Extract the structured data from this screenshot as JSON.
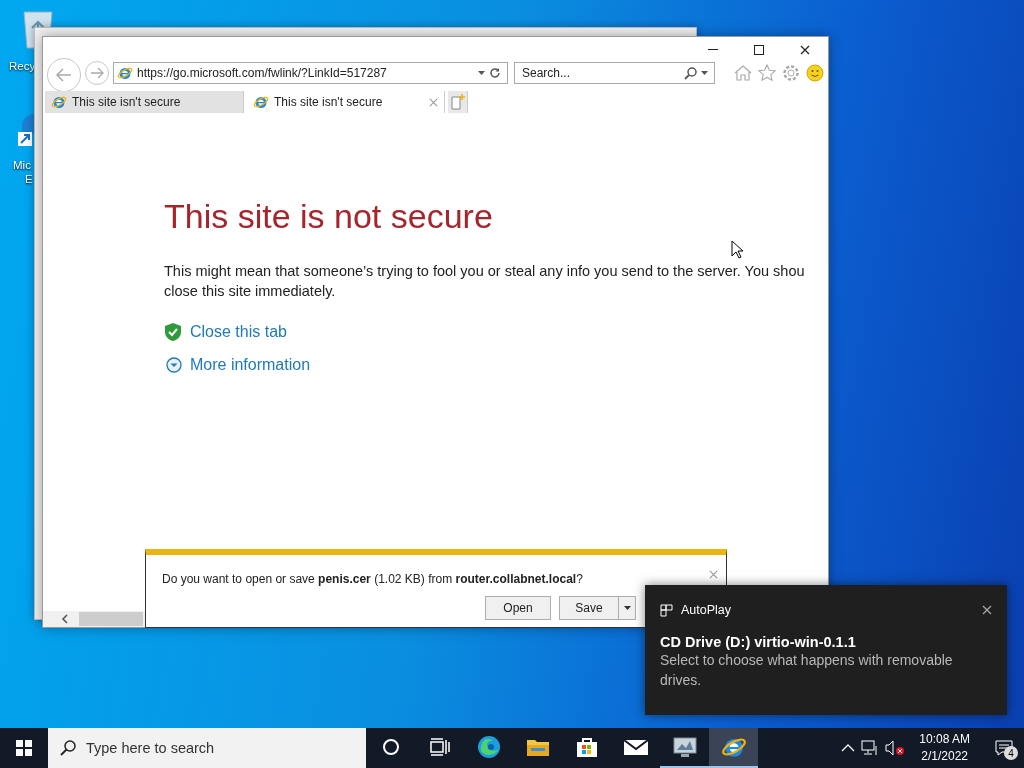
{
  "desktop": {
    "icons": [
      {
        "kind": "recycle",
        "label_lines": [
          "Recy"
        ]
      },
      {
        "kind": "edge",
        "label_lines": [
          "Mic",
          "E"
        ]
      }
    ]
  },
  "browser": {
    "address": "https://go.microsoft.com/fwlink/?LinkId=517287",
    "search": {
      "placeholder": "Search..."
    },
    "tabs": [
      {
        "label": "This site isn't secure",
        "selected": false
      },
      {
        "label": "This site isn't secure",
        "selected": true
      }
    ],
    "page": {
      "heading": "This site is not secure",
      "paragraph_lines": [
        "This might mean that someone’s trying to fool you or steal any info you send to the server. You shou",
        "close this site immediately."
      ],
      "links": [
        {
          "kind": "shield",
          "label": "Close this tab"
        },
        {
          "kind": "expand",
          "label": "More information"
        }
      ]
    }
  },
  "download_bar": {
    "message": "Do you want to open or save **penis.cer** (1.02 KB) from **router.collabnet.local**?",
    "buttons": [
      "Open",
      "Save"
    ]
  },
  "toast": {
    "app": "AutoPlay",
    "title": "CD Drive (D:) virtio-win-0.1.1",
    "body": "Select to choose what happens with removable drives."
  },
  "taskbar": {
    "search": {
      "placeholder": "Type here to search"
    },
    "apps": [
      {
        "kind": "cortana",
        "active": false,
        "running": false
      },
      {
        "kind": "taskview",
        "active": false,
        "running": false
      },
      {
        "kind": "edge",
        "active": false,
        "running": false
      },
      {
        "kind": "folder",
        "active": false,
        "running": false
      },
      {
        "kind": "store",
        "active": false,
        "running": false
      },
      {
        "kind": "mail",
        "active": false,
        "running": false
      },
      {
        "kind": "monitor",
        "active": false,
        "running": true
      },
      {
        "kind": "ie",
        "active": true,
        "running": true
      }
    ],
    "clock": {
      "time": "10:08 AM",
      "date": "2/1/2022"
    },
    "notifications": {
      "count": "4"
    }
  }
}
